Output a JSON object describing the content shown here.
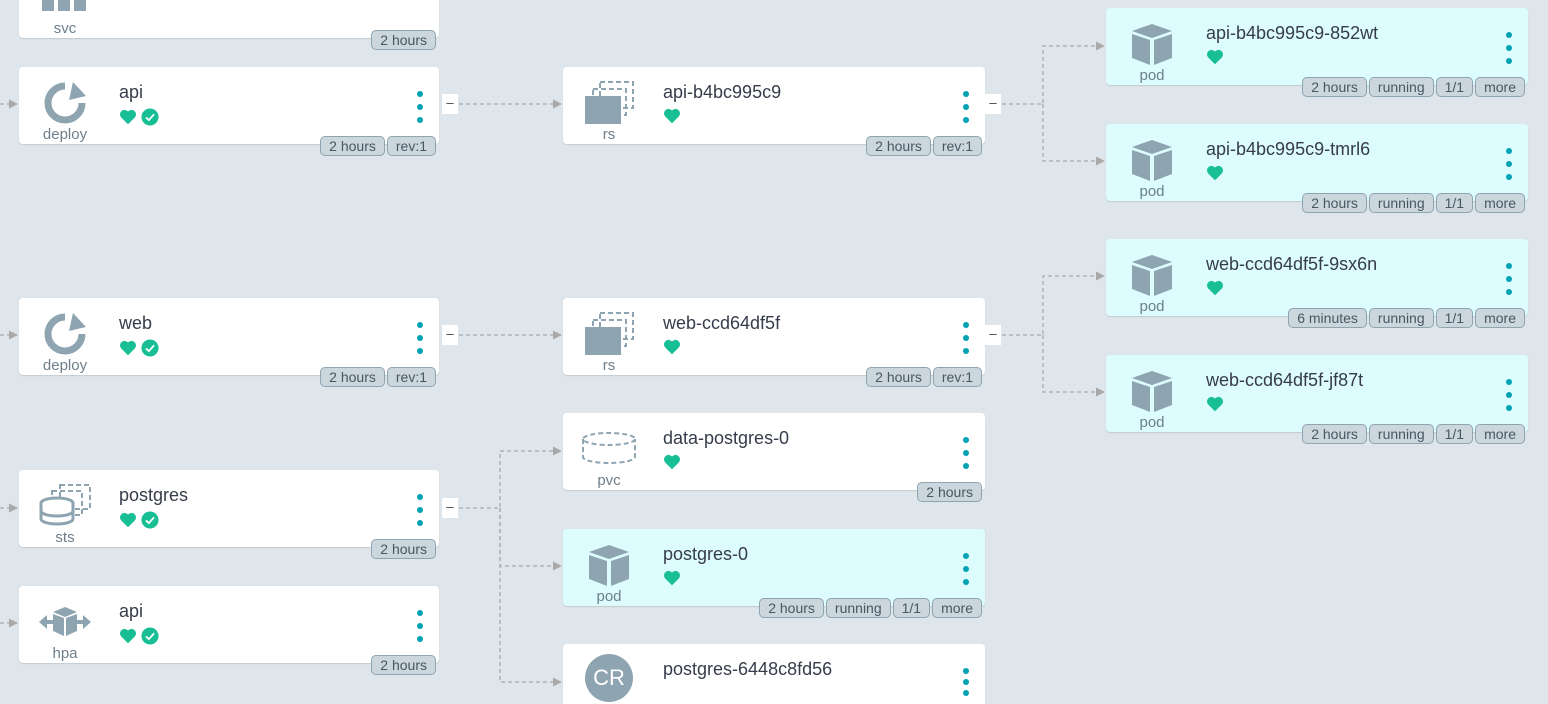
{
  "colors": {
    "healthy": "#18be94",
    "accent": "#00a2b3",
    "icon": "#8fa4b1",
    "edge": "#a9a9a9"
  },
  "nodes": {
    "svc_top": {
      "kind": "svc",
      "age": "2 hours"
    },
    "deploy_api": {
      "name": "api",
      "kind": "deploy",
      "age": "2 hours",
      "rev": "rev:1"
    },
    "rs_api": {
      "name": "api-b4bc995c9",
      "kind": "rs",
      "age": "2 hours",
      "rev": "rev:1"
    },
    "pod_api_1": {
      "name": "api-b4bc995c9-852wt",
      "kind": "pod",
      "age": "2 hours",
      "status": "running",
      "ready": "1/1",
      "more": "more"
    },
    "pod_api_2": {
      "name": "api-b4bc995c9-tmrl6",
      "kind": "pod",
      "age": "2 hours",
      "status": "running",
      "ready": "1/1",
      "more": "more"
    },
    "deploy_web": {
      "name": "web",
      "kind": "deploy",
      "age": "2 hours",
      "rev": "rev:1"
    },
    "rs_web": {
      "name": "web-ccd64df5f",
      "kind": "rs",
      "age": "2 hours",
      "rev": "rev:1"
    },
    "pod_web_1": {
      "name": "web-ccd64df5f-9sx6n",
      "kind": "pod",
      "age": "6 minutes",
      "status": "running",
      "ready": "1/1",
      "more": "more"
    },
    "pod_web_2": {
      "name": "web-ccd64df5f-jf87t",
      "kind": "pod",
      "age": "2 hours",
      "status": "running",
      "ready": "1/1",
      "more": "more"
    },
    "sts_postgres": {
      "name": "postgres",
      "kind": "sts",
      "age": "2 hours"
    },
    "pvc_postgres": {
      "name": "data-postgres-0",
      "kind": "pvc",
      "age": "2 hours"
    },
    "pod_postgres": {
      "name": "postgres-0",
      "kind": "pod",
      "age": "2 hours",
      "status": "running",
      "ready": "1/1",
      "more": "more"
    },
    "hpa_api": {
      "name": "api",
      "kind": "hpa",
      "age": "2 hours"
    },
    "cr_postgres": {
      "name": "postgres-6448c8fd56",
      "kind": "CR"
    }
  },
  "collapse_label": "–"
}
